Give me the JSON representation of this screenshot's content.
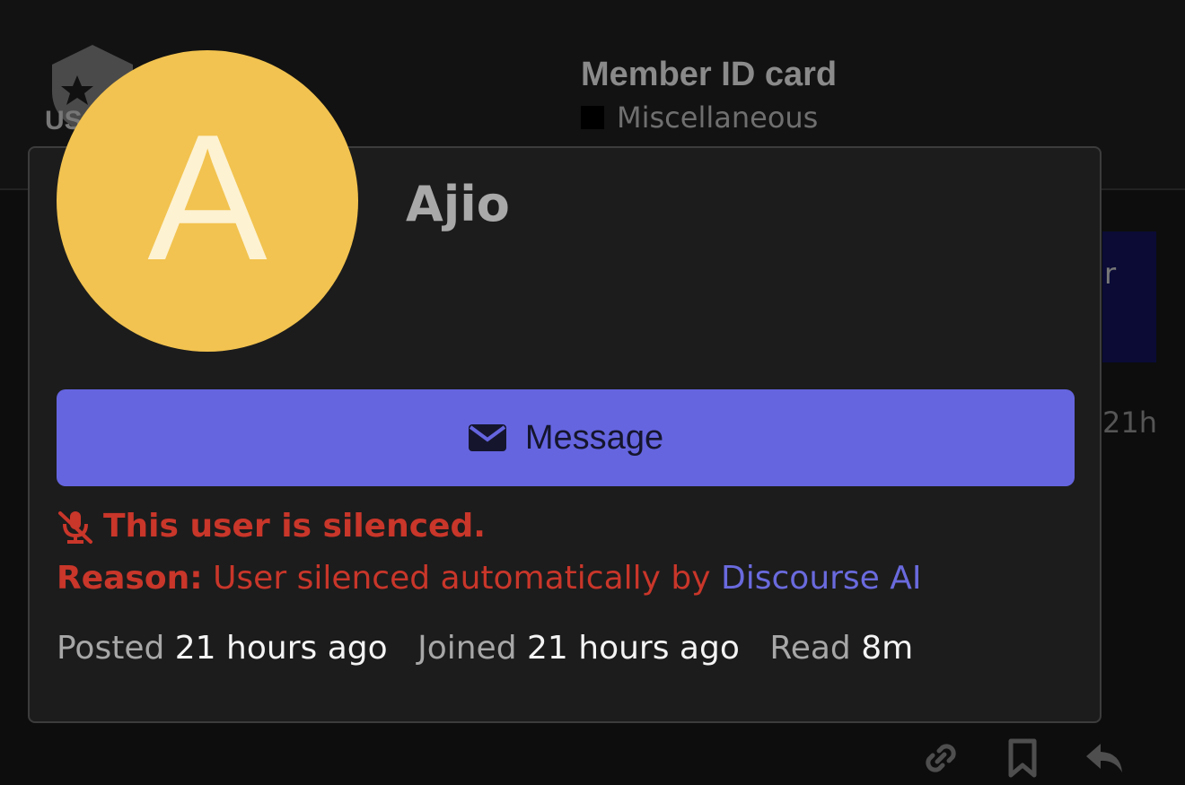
{
  "topic": {
    "title": "Member ID card",
    "category": "Miscellaneous"
  },
  "background": {
    "side_text": "r",
    "side_time": "21h",
    "logo_text": "US"
  },
  "user_card": {
    "avatar_letter": "A",
    "username": "Ajio",
    "message_label": "Message",
    "silenced_text": "This user is silenced.",
    "reason_label": "Reason:",
    "reason_text": "User silenced automatically by",
    "reason_link": "Discourse AI",
    "stats": {
      "posted_label": "Posted",
      "posted_value": "21 hours ago",
      "joined_label": "Joined",
      "joined_value": "21 hours ago",
      "read_label": "Read",
      "read_value": "8m"
    }
  },
  "icons": {
    "message": "envelope-icon",
    "silenced": "microphone-slash-icon",
    "post_actions": [
      "link-icon",
      "bookmark-icon",
      "reply-icon"
    ]
  },
  "colors": {
    "avatar_bg": "#f2c350",
    "button_bg": "#6565e0",
    "danger": "#c9362a",
    "link": "#6a6ade",
    "card_bg": "#1c1c1c"
  }
}
